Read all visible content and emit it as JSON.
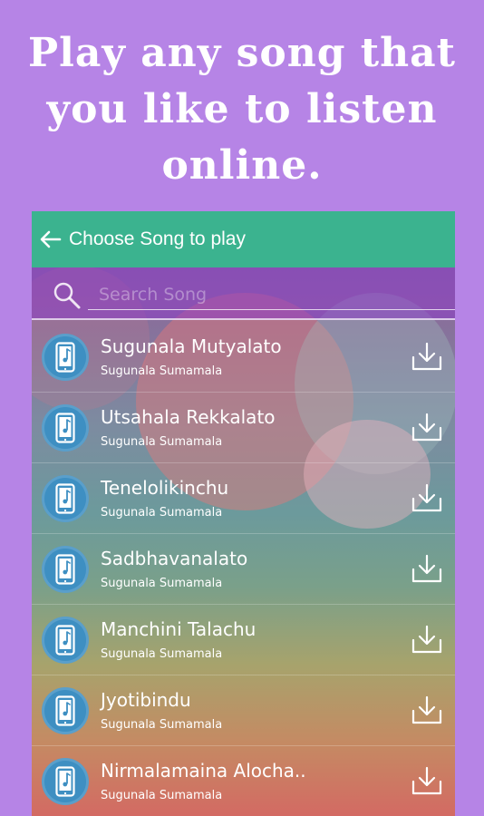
{
  "headline": {
    "line1": "Play any song that",
    "line2": "you like to listen",
    "line3": "online."
  },
  "appbar": {
    "title": "Choose Song to play",
    "back_icon": "arrow-left-icon"
  },
  "search": {
    "placeholder": "Search Song",
    "icon": "search-icon"
  },
  "colors": {
    "background": "#b684e6",
    "appbar": "#3bb38f",
    "avatar": "#3e8fc2"
  },
  "songs": [
    {
      "title": "Sugunala Mutyalato",
      "subtitle": "Sugunala Sumamala"
    },
    {
      "title": "Utsahala Rekkalato",
      "subtitle": "Sugunala Sumamala"
    },
    {
      "title": "Tenelolikinchu",
      "subtitle": "Sugunala Sumamala"
    },
    {
      "title": "Sadbhavanalato",
      "subtitle": "Sugunala Sumamala"
    },
    {
      "title": "Manchini Talachu",
      "subtitle": "Sugunala Sumamala"
    },
    {
      "title": "Jyotibindu",
      "subtitle": "Sugunala Sumamala"
    },
    {
      "title": "Nirmalamaina Alocha..",
      "subtitle": "Sugunala Sumamala"
    }
  ]
}
